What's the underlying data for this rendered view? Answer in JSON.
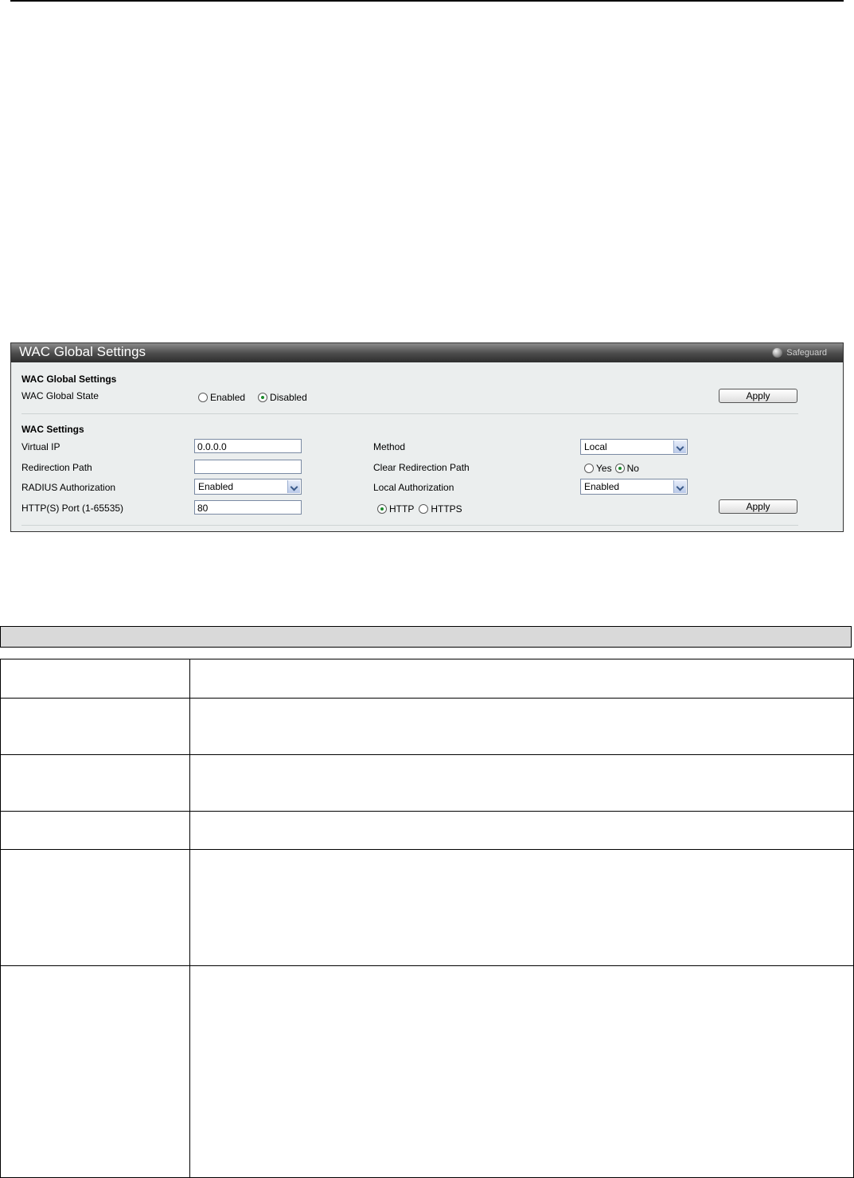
{
  "panel": {
    "title": "WAC Global Settings",
    "safeguard_label": "Safeguard",
    "global_section": {
      "title": "WAC Global Settings",
      "state_label": "WAC Global State",
      "options": [
        "Enabled",
        "Disabled"
      ],
      "selected": "Disabled",
      "apply_label": "Apply"
    },
    "wac_section": {
      "title": "WAC Settings",
      "virtual_ip_label": "Virtual IP",
      "virtual_ip_value": "0.0.0.0",
      "redirection_path_label": "Redirection Path",
      "redirection_path_value": "",
      "radius_auth_label": "RADIUS Authorization",
      "radius_auth_value": "Enabled",
      "port_label": "HTTP(S) Port (1-65535)",
      "port_value": "80",
      "method_label": "Method",
      "method_value": "Local",
      "clear_path_label": "Clear Redirection Path",
      "clear_path_options": [
        "Yes",
        "No"
      ],
      "clear_path_selected": "No",
      "local_auth_label": "Local Authorization",
      "local_auth_value": "Enabled",
      "protocol_options": [
        "HTTP",
        "HTTPS"
      ],
      "protocol_selected": "HTTP",
      "apply_label": "Apply"
    }
  },
  "colors": {
    "panel_bg": "#ebeeee",
    "header_dark": "#2e2e2e",
    "radio_check": "#1a8a2a",
    "gray_bar": "#d9d9d9"
  }
}
